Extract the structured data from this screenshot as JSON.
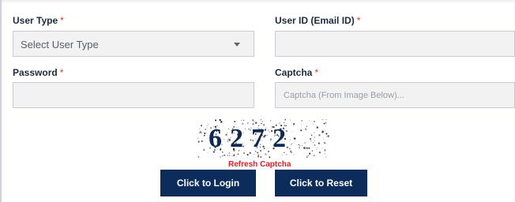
{
  "form": {
    "user_type": {
      "label": "User Type",
      "required_mark": "*",
      "selected": "Select User Type"
    },
    "user_id": {
      "label": "User ID (Email ID)",
      "required_mark": "*",
      "value": "",
      "placeholder": ""
    },
    "password": {
      "label": "Password",
      "required_mark": "*",
      "value": "",
      "placeholder": ""
    },
    "captcha": {
      "label": "Captcha",
      "required_mark": "*",
      "value": "",
      "placeholder": "Captcha (From Image Below)..."
    }
  },
  "captcha_image": {
    "text": "6272",
    "refresh_label": "Refresh Captcha"
  },
  "buttons": {
    "login_label": "Click to Login",
    "reset_label": "Click to Reset"
  },
  "colors": {
    "primary": "#0c2c5c",
    "required": "#e0353b",
    "refresh": "#d8232a",
    "field_bg": "#f2f2f2"
  },
  "icons": {
    "dropdown": "chevron-down-icon"
  }
}
